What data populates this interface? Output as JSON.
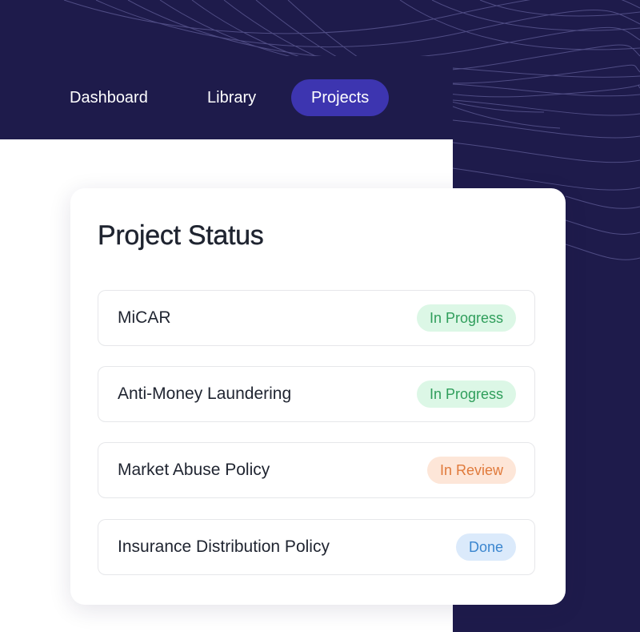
{
  "nav": {
    "items": [
      {
        "label": "Dashboard",
        "active": false
      },
      {
        "label": "Library",
        "active": false
      },
      {
        "label": "Projects",
        "active": true
      }
    ]
  },
  "card": {
    "title": "Project Status",
    "projects": [
      {
        "name": "MiCAR",
        "status": "In Progress",
        "status_key": "progress"
      },
      {
        "name": "Anti-Money Laundering",
        "status": "In Progress",
        "status_key": "progress"
      },
      {
        "name": "Market Abuse Policy",
        "status": "In Review",
        "status_key": "review"
      },
      {
        "name": "Insurance Distribution Policy",
        "status": "Done",
        "status_key": "done"
      }
    ]
  },
  "colors": {
    "background": "#1e1b4b",
    "nav_active": "#3d35b0",
    "progress_bg": "#dcf7e6",
    "progress_text": "#2f9e5b",
    "review_bg": "#fde6d8",
    "review_text": "#e07a3b",
    "done_bg": "#dbeafb",
    "done_text": "#3b86cf"
  }
}
